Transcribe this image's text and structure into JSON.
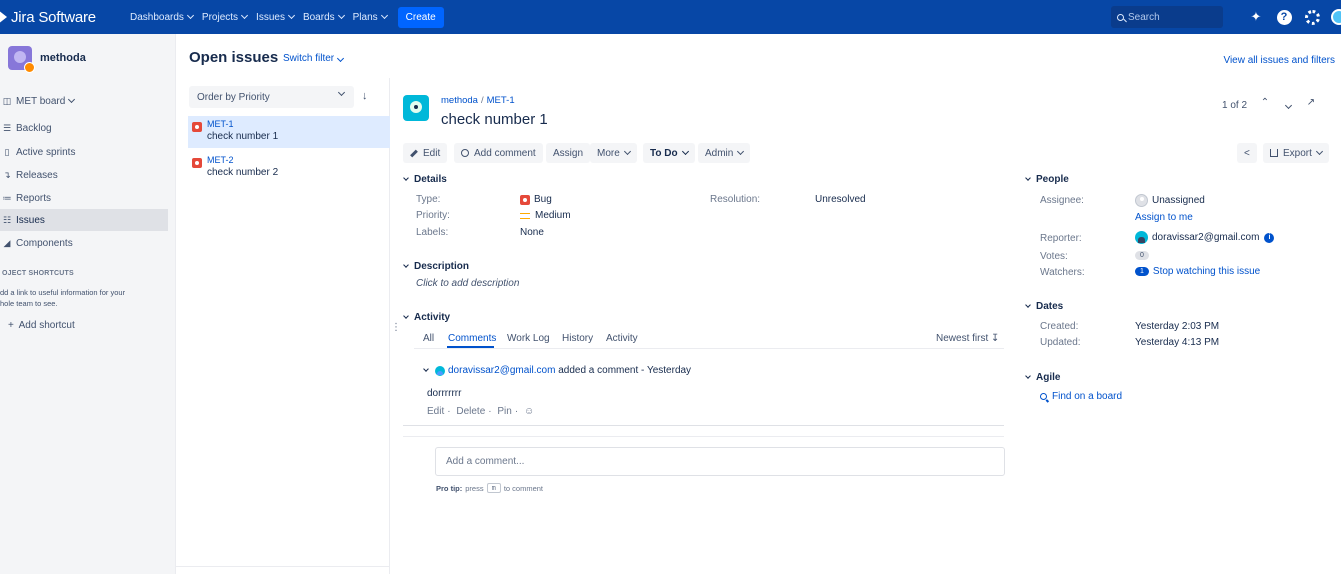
{
  "topnav": {
    "brand": "Jira Software",
    "items": [
      "Dashboards",
      "Projects",
      "Issues",
      "Boards",
      "Plans"
    ],
    "create_label": "Create",
    "search_placeholder": "Search"
  },
  "sidebar": {
    "project_name": "methoda",
    "items": [
      {
        "label": "MET board",
        "icon": "board-icon"
      },
      {
        "label": "Backlog",
        "icon": "backlog-icon"
      },
      {
        "label": "Active sprints",
        "icon": "sprint-icon"
      },
      {
        "label": "Releases",
        "icon": "release-icon"
      },
      {
        "label": "Reports",
        "icon": "reports-icon"
      },
      {
        "label": "Issues",
        "icon": "issues-icon",
        "active": true
      },
      {
        "label": "Components",
        "icon": "components-icon"
      }
    ],
    "shortcuts_heading": "OJECT SHORTCUTS",
    "shortcuts_help_1": "dd a link to useful information for your",
    "shortcuts_help_2": "hole team to see.",
    "add_shortcut": "Add shortcut"
  },
  "header": {
    "title": "Open issues",
    "switch_filter": "Switch filter",
    "view_all": "View all issues and filters"
  },
  "list": {
    "order_by": "Order by Priority",
    "issues": [
      {
        "key": "MET-1",
        "summary": "check number 1",
        "selected": true
      },
      {
        "key": "MET-2",
        "summary": "check number 2",
        "selected": false
      }
    ]
  },
  "issue": {
    "project": "methoda",
    "key": "MET-1",
    "title": "check number 1",
    "pager": "1 of 2",
    "toolbar": {
      "edit": "Edit",
      "add_comment": "Add comment",
      "assign": "Assign",
      "more": "More",
      "status": "To Do",
      "admin": "Admin",
      "export": "Export"
    },
    "details": {
      "heading": "Details",
      "type_label": "Type:",
      "type_value": "Bug",
      "priority_label": "Priority:",
      "priority_value": "Medium",
      "labels_label": "Labels:",
      "labels_value": "None",
      "resolution_label": "Resolution:",
      "resolution_value": "Unresolved"
    },
    "description": {
      "heading": "Description",
      "placeholder": "Click to add description"
    },
    "activity": {
      "heading": "Activity",
      "tabs": [
        "All",
        "Comments",
        "Work Log",
        "History",
        "Activity"
      ],
      "active_tab": "Comments",
      "sort": "Newest first",
      "comment": {
        "author": "doravissar2@gmail.com",
        "meta": " added a comment - Yesterday",
        "body": "dorrrrrrr",
        "actions": [
          "Edit",
          "Delete",
          "Pin"
        ]
      },
      "add_placeholder": "Add a comment...",
      "pro_tip_label": "Pro tip:",
      "pro_tip_pre": "press",
      "pro_tip_key": "m",
      "pro_tip_post": "to comment"
    },
    "people": {
      "heading": "People",
      "assignee_label": "Assignee:",
      "assignee_value": "Unassigned",
      "assign_to_me": "Assign to me",
      "reporter_label": "Reporter:",
      "reporter_value": "doravissar2@gmail.com",
      "votes_label": "Votes:",
      "votes_value": "0",
      "watchers_label": "Watchers:",
      "watchers_count": "1",
      "watchers_action": "Stop watching this issue"
    },
    "dates": {
      "heading": "Dates",
      "created_label": "Created:",
      "created_value": "Yesterday 2:03 PM",
      "updated_label": "Updated:",
      "updated_value": "Yesterday 4:13 PM"
    },
    "agile": {
      "heading": "Agile",
      "find": "Find on a board"
    }
  },
  "colors": {
    "nav": "#0747a6",
    "link": "#0052cc",
    "bug": "#e5493a",
    "priority_medium": "#ffab00"
  }
}
